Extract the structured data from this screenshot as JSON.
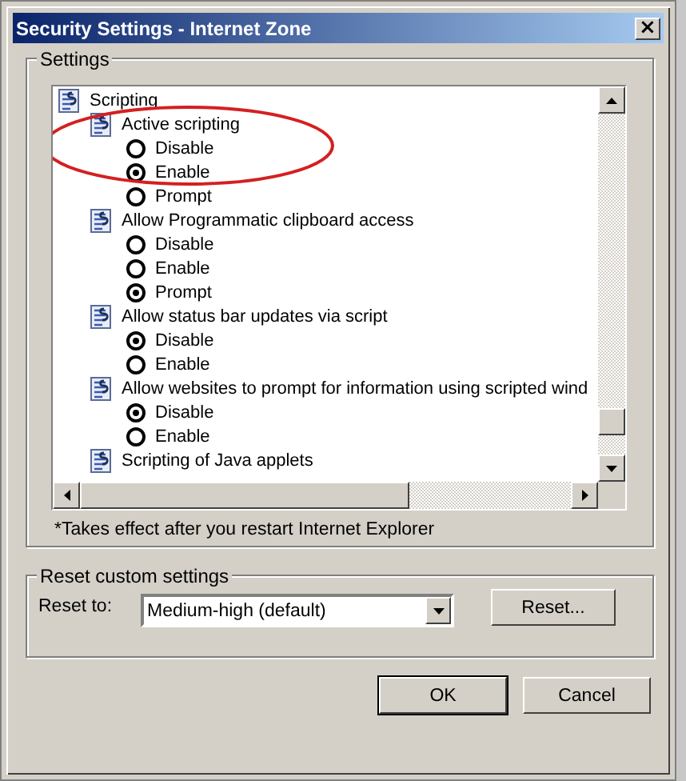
{
  "window": {
    "title": "Security Settings - Internet Zone",
    "close": "×"
  },
  "settings_group": {
    "legend": "Settings",
    "tree": [
      {
        "label": "Scripting",
        "children": [
          {
            "label": "Active scripting",
            "options": [
              {
                "label": "Disable",
                "selected": false
              },
              {
                "label": "Enable",
                "selected": true
              },
              {
                "label": "Prompt",
                "selected": false
              }
            ]
          },
          {
            "label": "Allow Programmatic clipboard access",
            "options": [
              {
                "label": "Disable",
                "selected": false
              },
              {
                "label": "Enable",
                "selected": false
              },
              {
                "label": "Prompt",
                "selected": true
              }
            ]
          },
          {
            "label": "Allow status bar updates via script",
            "options": [
              {
                "label": "Disable",
                "selected": true
              },
              {
                "label": "Enable",
                "selected": false
              }
            ]
          },
          {
            "label": "Allow websites to prompt for information using scripted wind",
            "options": [
              {
                "label": "Disable",
                "selected": true
              },
              {
                "label": "Enable",
                "selected": false
              }
            ]
          },
          {
            "label": "Scripting of Java applets"
          }
        ]
      }
    ],
    "note": "*Takes effect after you restart Internet Explorer"
  },
  "annotations": [
    {
      "kind": "ellipse",
      "color": "#d42020"
    }
  ],
  "reset_group": {
    "legend": "Reset custom settings",
    "label": "Reset to:",
    "value": "Medium-high (default)",
    "button": "Reset..."
  },
  "buttons": [
    "OK",
    "Cancel"
  ]
}
